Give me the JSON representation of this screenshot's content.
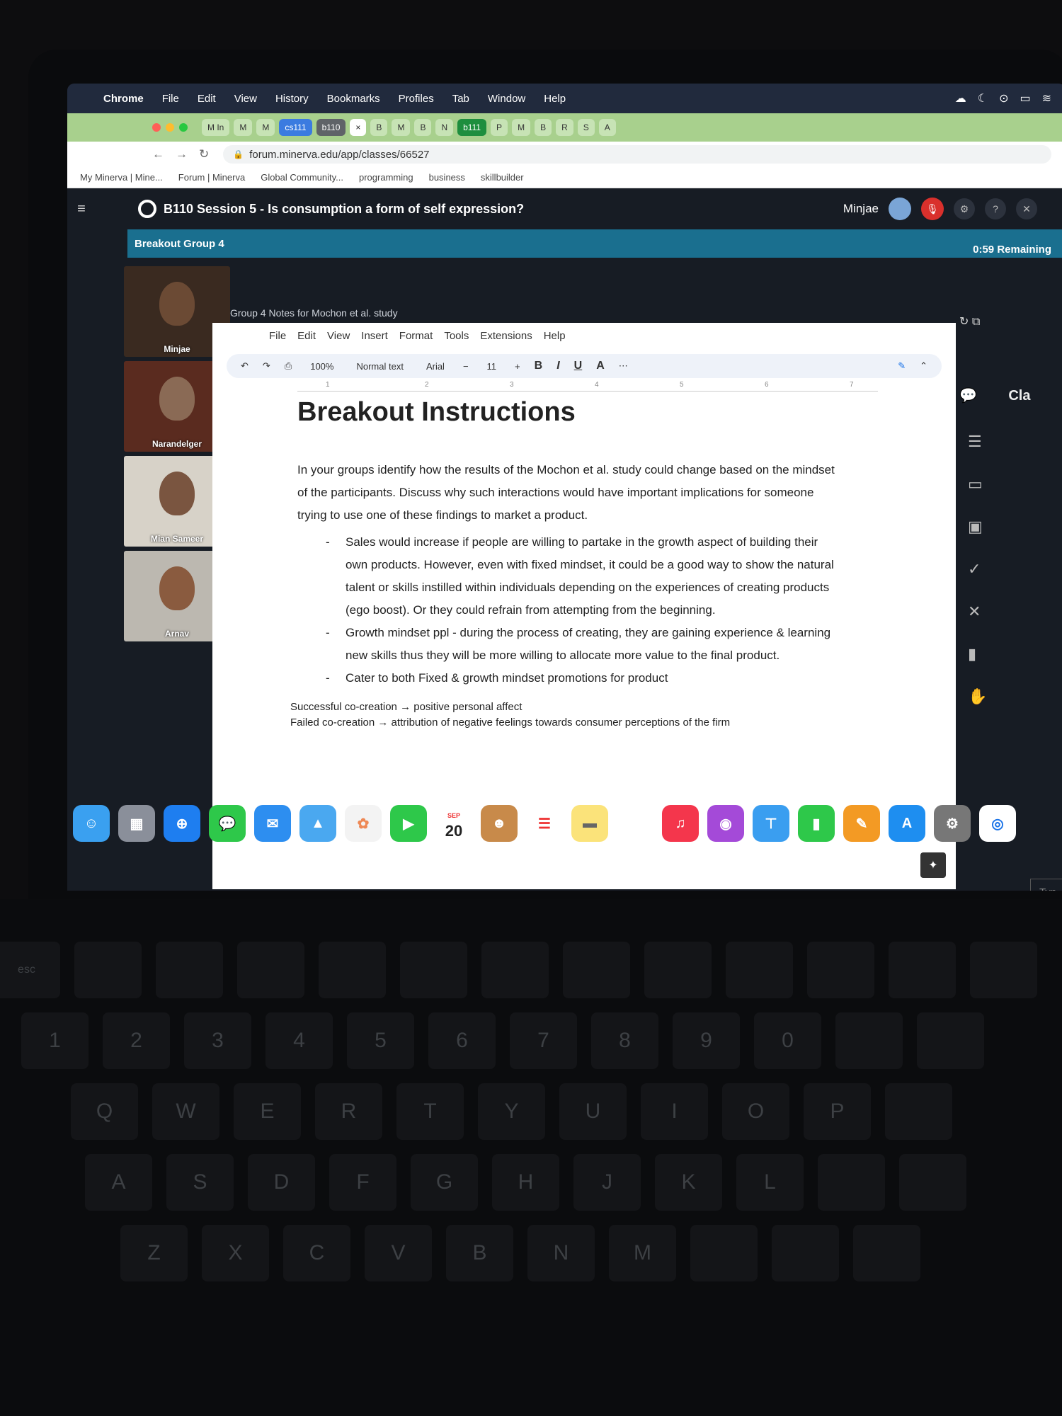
{
  "menubar": {
    "app": "Chrome",
    "items": [
      "File",
      "Edit",
      "View",
      "History",
      "Bookmarks",
      "Profiles",
      "Tab",
      "Window",
      "Help"
    ]
  },
  "tabs": [
    {
      "label": "M In",
      "style": "plain"
    },
    {
      "label": "M",
      "style": "plain"
    },
    {
      "label": "M",
      "style": "plain"
    },
    {
      "label": "cs111",
      "style": "blue"
    },
    {
      "label": "b110",
      "style": "gray"
    },
    {
      "label": "×",
      "style": "active"
    },
    {
      "label": "B",
      "style": "plain"
    },
    {
      "label": "M",
      "style": "plain"
    },
    {
      "label": "B",
      "style": "plain"
    },
    {
      "label": "N",
      "style": "plain"
    },
    {
      "label": "b111",
      "style": "green"
    },
    {
      "label": "P",
      "style": "plain"
    },
    {
      "label": "M",
      "style": "plain"
    },
    {
      "label": "B",
      "style": "plain"
    },
    {
      "label": "R",
      "style": "plain"
    },
    {
      "label": "S",
      "style": "plain"
    },
    {
      "label": "A",
      "style": "plain"
    }
  ],
  "address": "forum.minerva.edu/app/classes/66527",
  "bookmarks": [
    "My Minerva | Mine...",
    "Forum | Minerva",
    "Global Community...",
    "programming",
    "business",
    "skillbuilder"
  ],
  "app": {
    "session_title": "B110 Session 5 - Is consumption a form of self expression?",
    "user": "Minjae",
    "breakout": "Breakout Group 4",
    "remaining": "0:59 Remaining",
    "participants": [
      "Minjae",
      "Narandelger",
      "Mian Sameer",
      "Arnav"
    ],
    "doc_caption": "Group 4 Notes for Mochon et al. study"
  },
  "docs": {
    "menu": [
      "File",
      "Edit",
      "View",
      "Insert",
      "Format",
      "Tools",
      "Extensions",
      "Help"
    ],
    "zoom": "100%",
    "style": "Normal text",
    "font": "Arial",
    "size": "11",
    "heading": "Breakout Instructions",
    "intro": "In your groups identify how the results of the Mochon et al. study could change based on the mindset of the participants. Discuss why such interactions would have important implications for someone trying to use one of these findings to market a product.",
    "bullets": [
      "Sales would increase if people are willing to partake in the growth aspect of building their own products. However, even with fixed mindset, it could be a good way to show the natural talent or skills instilled within individuals depending on the experiences of creating products (ego boost). Or they could refrain from attempting from the beginning.",
      "Growth mindset ppl - during the process of creating, they are gaining experience & learning new skills thus they will be more willing to allocate more value to the final product.",
      "Cater to both Fixed & growth mindset promotions for product"
    ],
    "note1": "Successful co-creation → positive personal affect",
    "note2": "Failed co-creation → attribution of negative feelings towards consumer perceptions of the firm"
  },
  "right_panel": {
    "label": "Cla",
    "type_placeholder": "Typ"
  },
  "dock": {
    "calendar_month": "SEP",
    "calendar_day": "20",
    "tv_label": "tv"
  }
}
